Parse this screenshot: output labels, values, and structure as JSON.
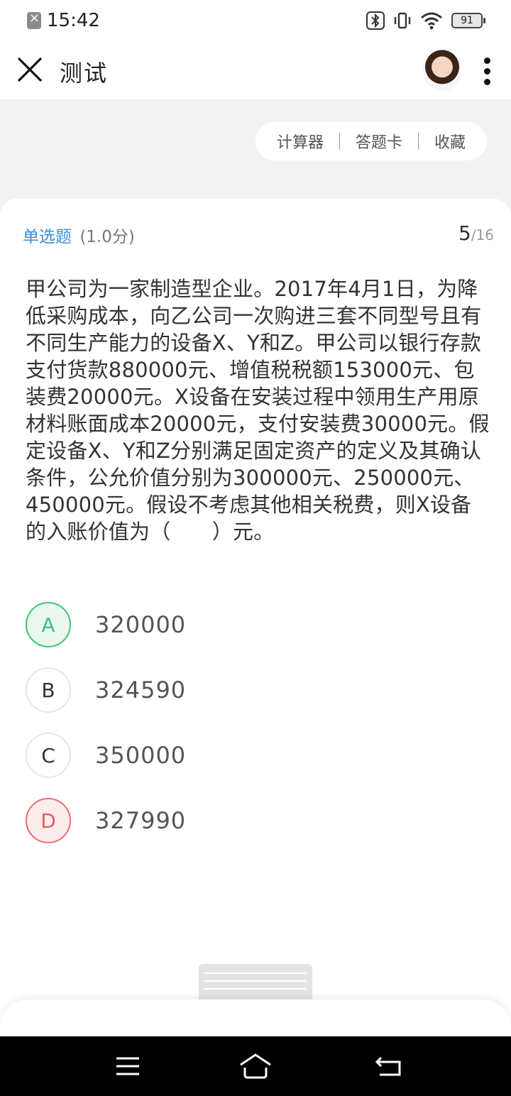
{
  "status_bar": {
    "time": "15:42",
    "battery": "91",
    "icons": [
      "notification-icon",
      "bluetooth-icon",
      "vibrate-icon",
      "wifi-icon",
      "battery-icon"
    ]
  },
  "header": {
    "title": "测试",
    "icons": [
      "close-icon",
      "avatar",
      "more-icon"
    ]
  },
  "toolbar": {
    "calculator": "计算器",
    "answer_card": "答题卡",
    "favorite": "收藏"
  },
  "question": {
    "type": "单选题",
    "score": "(1.0分)",
    "current": "5",
    "total": "/16",
    "text": "甲公司为一家制造型企业。2017年4月1日，为降低采购成本，向乙公司一次购进三套不同型号且有不同生产能力的设备X、Y和Z。甲公司以银行存款支付货款880000元、增值税税额153000元、包装费20000元。X设备在安装过程中领用生产用原材料账面成本20000元，支付安装费30000元。假定设备X、Y和Z分别满足固定资产的定义及其确认条件，公允价值分别为300000元、250000元、450000元。假设不考虑其他相关税费，则X设备的入账价值为（　　）元。"
  },
  "options": [
    {
      "letter": "A",
      "value": "320000",
      "state": "correct"
    },
    {
      "letter": "B",
      "value": "324590",
      "state": "none"
    },
    {
      "letter": "C",
      "value": "350000",
      "state": "none"
    },
    {
      "letter": "D",
      "value": "327990",
      "state": "wrong"
    }
  ],
  "colors": {
    "accent": "#3b8fd9",
    "correct": "#3cc27a",
    "wrong": "#e35b5b"
  },
  "navbar": {
    "icons": [
      "menu-icon",
      "home-icon",
      "back-icon"
    ]
  }
}
